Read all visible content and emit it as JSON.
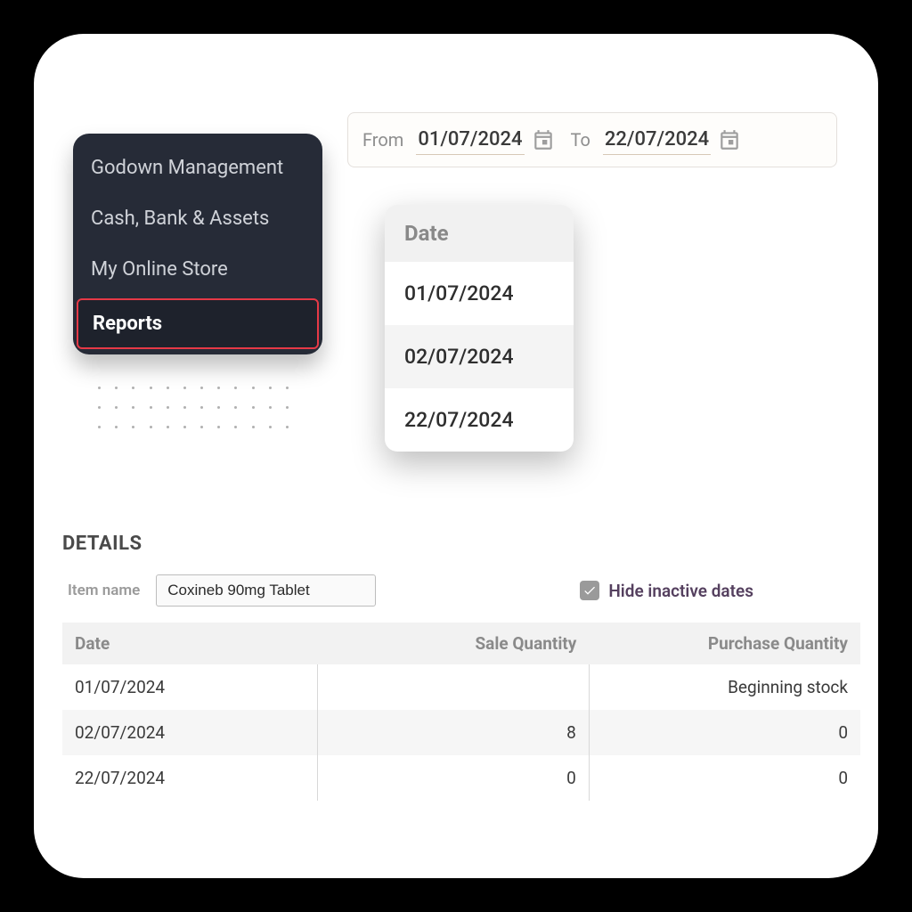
{
  "sidebar": {
    "items": [
      {
        "label": "Godown Management",
        "active": false
      },
      {
        "label": "Cash, Bank & Assets",
        "active": false
      },
      {
        "label": "My Online Store",
        "active": false
      },
      {
        "label": "Reports",
        "active": true
      }
    ]
  },
  "date_range": {
    "from_label": "From",
    "from_value": "01/07/2024",
    "to_label": "To",
    "to_value": "22/07/2024"
  },
  "date_popup": {
    "header": "Date",
    "rows": [
      "01/07/2024",
      "02/07/2024",
      "22/07/2024"
    ]
  },
  "details": {
    "title": "DETAILS",
    "item_name_label": "Item name",
    "item_name_value": "Coxineb 90mg Tablet",
    "hide_inactive_label": "Hide inactive dates",
    "hide_inactive_checked": true,
    "columns": {
      "date": "Date",
      "sale": "Sale Quantity",
      "purchase": "Purchase Quantity"
    },
    "rows": [
      {
        "date": "01/07/2024",
        "sale": "",
        "purchase": "Beginning stock"
      },
      {
        "date": "02/07/2024",
        "sale": "8",
        "purchase": "0"
      },
      {
        "date": "22/07/2024",
        "sale": "0",
        "purchase": "0"
      }
    ]
  }
}
